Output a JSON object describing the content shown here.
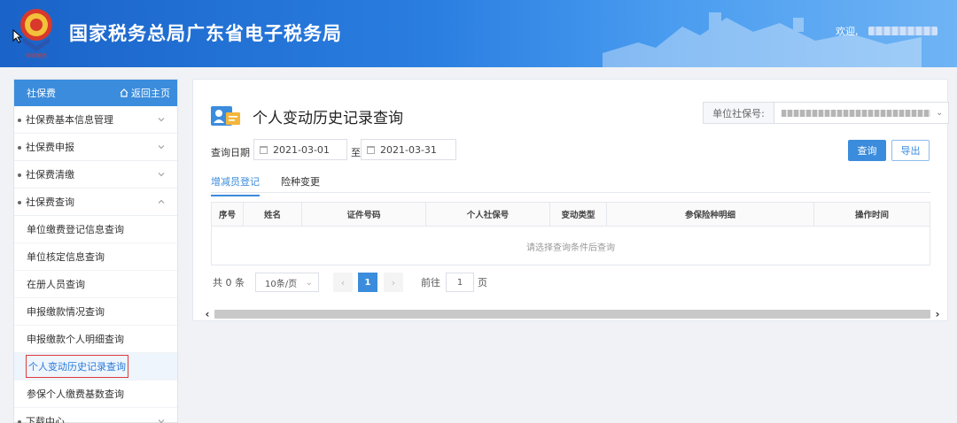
{
  "header": {
    "site_title": "国家税务总局广东省电子税务局",
    "welcome": "欢迎,",
    "emblem_caption": "中国税务"
  },
  "sidebar": {
    "title": "社保费",
    "home_label": "返回主页",
    "groups": [
      {
        "label": "社保费基本信息管理",
        "expanded": false
      },
      {
        "label": "社保费申报",
        "expanded": false
      },
      {
        "label": "社保费清缴",
        "expanded": false
      },
      {
        "label": "社保费查询",
        "expanded": true
      }
    ],
    "sub_items": [
      "单位缴费登记信息查询",
      "单位核定信息查询",
      "在册人员查询",
      "申报缴款情况查询",
      "申报缴款个人明细查询",
      "个人变动历史记录查询",
      "参保个人缴费基数查询"
    ],
    "active_sub": "个人变动历史记录查询",
    "last_group": "下载中心"
  },
  "main": {
    "title": "个人变动历史记录查询",
    "unit_label": "单位社保号:",
    "date_label": "查询日期",
    "date_from": "2021-03-01",
    "date_sep": "至",
    "date_to": "2021-03-31",
    "query_button": "查询",
    "export_button": "导出",
    "tabs": [
      "增减员登记",
      "险种变更"
    ],
    "active_tab": 0,
    "table": {
      "columns": [
        "序号",
        "姓名",
        "证件号码",
        "个人社保号",
        "变动类型",
        "参保险种明细",
        "操作时间"
      ],
      "empty_text": "请选择查询条件后查询"
    },
    "pager": {
      "total": "共 0 条",
      "page_size": "10条/页",
      "current_page": "1",
      "goto_prefix": "前往",
      "goto_value": "1",
      "goto_suffix": "页"
    }
  },
  "colors": {
    "primary": "#3b8cdc",
    "header_start": "#1a63c8",
    "active_border": "#e03a3a"
  }
}
